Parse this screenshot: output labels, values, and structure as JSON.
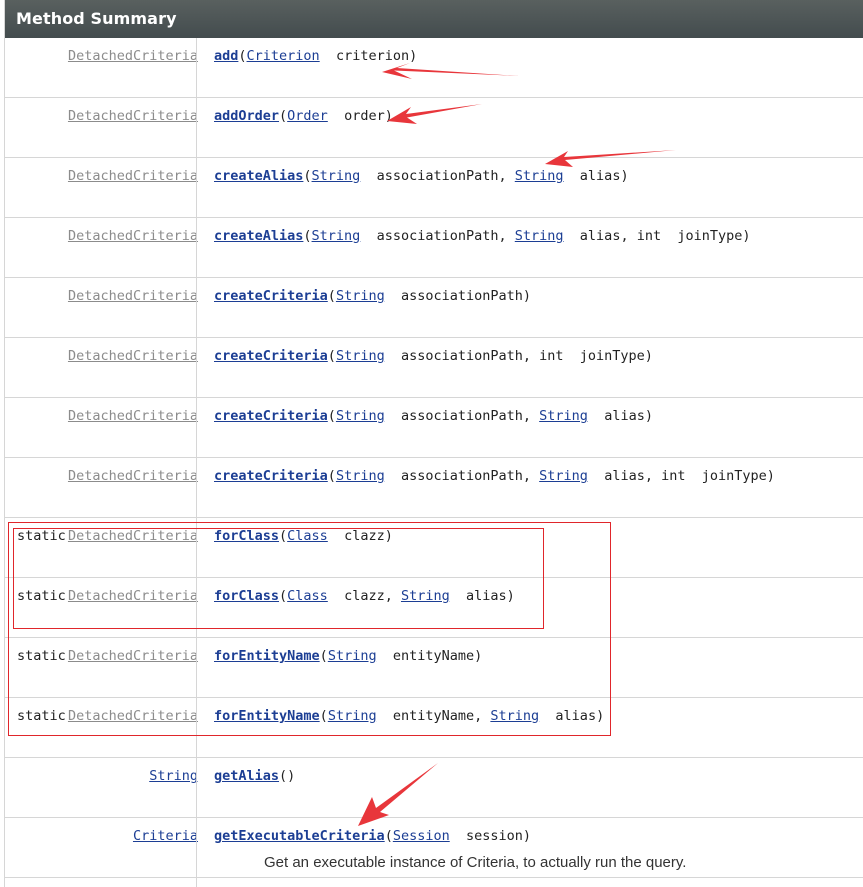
{
  "header": {
    "title": "Method Summary"
  },
  "rows": [
    {
      "static": "",
      "ret": "DetachedCriteria",
      "ret_style": "gray",
      "sig": [
        {
          "t": "m",
          "v": "add"
        },
        {
          "t": "p",
          "v": "("
        },
        {
          "t": "l",
          "v": "Criterion"
        },
        {
          "t": "p",
          "v": "  criterion)"
        }
      ]
    },
    {
      "static": "",
      "ret": "DetachedCriteria",
      "ret_style": "gray",
      "sig": [
        {
          "t": "m",
          "v": "addOrder"
        },
        {
          "t": "p",
          "v": "("
        },
        {
          "t": "l",
          "v": "Order"
        },
        {
          "t": "p",
          "v": "  order)"
        }
      ]
    },
    {
      "static": "",
      "ret": "DetachedCriteria",
      "ret_style": "gray",
      "sig": [
        {
          "t": "m",
          "v": "createAlias"
        },
        {
          "t": "p",
          "v": "("
        },
        {
          "t": "l",
          "v": "String"
        },
        {
          "t": "p",
          "v": "  associationPath, "
        },
        {
          "t": "l",
          "v": "String"
        },
        {
          "t": "p",
          "v": "  alias)"
        }
      ]
    },
    {
      "static": "",
      "ret": "DetachedCriteria",
      "ret_style": "gray",
      "sig": [
        {
          "t": "m",
          "v": "createAlias"
        },
        {
          "t": "p",
          "v": "("
        },
        {
          "t": "l",
          "v": "String"
        },
        {
          "t": "p",
          "v": "  associationPath, "
        },
        {
          "t": "l",
          "v": "String"
        },
        {
          "t": "p",
          "v": "  alias, int  joinType)"
        }
      ]
    },
    {
      "static": "",
      "ret": "DetachedCriteria",
      "ret_style": "gray",
      "sig": [
        {
          "t": "m",
          "v": "createCriteria"
        },
        {
          "t": "p",
          "v": "("
        },
        {
          "t": "l",
          "v": "String"
        },
        {
          "t": "p",
          "v": "  associationPath)"
        }
      ]
    },
    {
      "static": "",
      "ret": "DetachedCriteria",
      "ret_style": "gray",
      "sig": [
        {
          "t": "m",
          "v": "createCriteria"
        },
        {
          "t": "p",
          "v": "("
        },
        {
          "t": "l",
          "v": "String"
        },
        {
          "t": "p",
          "v": "  associationPath, int  joinType)"
        }
      ]
    },
    {
      "static": "",
      "ret": "DetachedCriteria",
      "ret_style": "gray",
      "sig": [
        {
          "t": "m",
          "v": "createCriteria"
        },
        {
          "t": "p",
          "v": "("
        },
        {
          "t": "l",
          "v": "String"
        },
        {
          "t": "p",
          "v": "  associationPath, "
        },
        {
          "t": "l",
          "v": "String"
        },
        {
          "t": "p",
          "v": "  alias)"
        }
      ]
    },
    {
      "static": "",
      "ret": "DetachedCriteria",
      "ret_style": "gray",
      "sig": [
        {
          "t": "m",
          "v": "createCriteria"
        },
        {
          "t": "p",
          "v": "("
        },
        {
          "t": "l",
          "v": "String"
        },
        {
          "t": "p",
          "v": "  associationPath, "
        },
        {
          "t": "l",
          "v": "String"
        },
        {
          "t": "p",
          "v": "  alias, int  joinType)"
        }
      ]
    },
    {
      "static": "static",
      "ret": "DetachedCriteria",
      "ret_style": "gray",
      "sig": [
        {
          "t": "m",
          "v": "forClass"
        },
        {
          "t": "p",
          "v": "("
        },
        {
          "t": "l",
          "v": "Class"
        },
        {
          "t": "p",
          "v": "  clazz)"
        }
      ]
    },
    {
      "static": "static",
      "ret": "DetachedCriteria",
      "ret_style": "gray",
      "sig": [
        {
          "t": "m",
          "v": "forClass"
        },
        {
          "t": "p",
          "v": "("
        },
        {
          "t": "l",
          "v": "Class"
        },
        {
          "t": "p",
          "v": "  clazz, "
        },
        {
          "t": "l",
          "v": "String"
        },
        {
          "t": "p",
          "v": "  alias)"
        }
      ]
    },
    {
      "static": "static",
      "ret": "DetachedCriteria",
      "ret_style": "gray",
      "sig": [
        {
          "t": "m",
          "v": "forEntityName"
        },
        {
          "t": "p",
          "v": "("
        },
        {
          "t": "l",
          "v": "String"
        },
        {
          "t": "p",
          "v": "  entityName)"
        }
      ]
    },
    {
      "static": "static",
      "ret": "DetachedCriteria",
      "ret_style": "gray",
      "sig": [
        {
          "t": "m",
          "v": "forEntityName"
        },
        {
          "t": "p",
          "v": "("
        },
        {
          "t": "l",
          "v": "String"
        },
        {
          "t": "p",
          "v": "  entityName, "
        },
        {
          "t": "l",
          "v": "String"
        },
        {
          "t": "p",
          "v": "  alias)"
        }
      ]
    },
    {
      "static": "",
      "ret": "String",
      "ret_style": "blue",
      "sig": [
        {
          "t": "m",
          "v": "getAlias"
        },
        {
          "t": "p",
          "v": "()"
        }
      ]
    },
    {
      "static": "",
      "ret": "Criteria",
      "ret_style": "blue",
      "sig": [
        {
          "t": "m",
          "v": "getExecutableCriteria"
        },
        {
          "t": "p",
          "v": "("
        },
        {
          "t": "l",
          "v": "Session"
        },
        {
          "t": "p",
          "v": "  session)"
        }
      ],
      "desc": "Get an executable instance of Criteria, to actually run the query."
    }
  ],
  "colors": {
    "header_bg": "#4d5556",
    "link": "#1c3e94",
    "muted_link": "#8c8c8c",
    "annotation_red": "#e0262b"
  }
}
